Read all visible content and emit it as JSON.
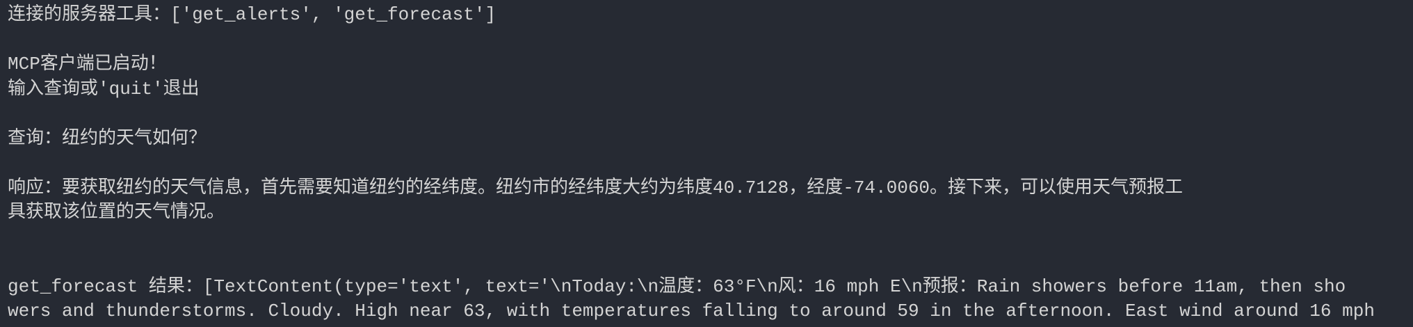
{
  "colors": {
    "background": "#262a33",
    "text": "#d4d4d4"
  },
  "terminal": {
    "lines": [
      "连接的服务器工具：['get_alerts', 'get_forecast']",
      "",
      "MCP客户端已启动！",
      "输入查询或'quit'退出",
      "",
      "查询：纽约的天气如何？",
      "",
      "响应：要获取纽约的天气信息，首先需要知道纽约的经纬度。纽约市的经纬度大约为纬度40.7128，经度-74.0060。接下来，可以使用天气预报工",
      "具获取该位置的天气情况。",
      "",
      "",
      "get_forecast 结果：[TextContent(type='text', text='\\nToday:\\n温度：63°F\\n风：16 mph E\\n预报：Rain showers before 11am, then sho",
      "wers and thunderstorms. Cloudy. High near 63, with temperatures falling to around 59 in the afternoon. East wind around 16 mph"
    ]
  }
}
